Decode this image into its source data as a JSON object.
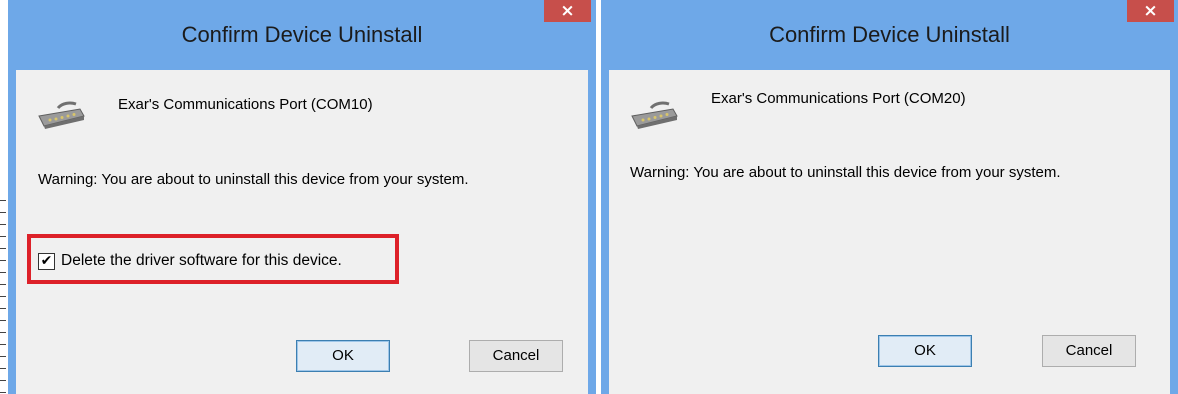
{
  "dialogs": [
    {
      "title": "Confirm Device Uninstall",
      "close_label": "×",
      "device_name": "Exar's Communications Port (COM10)",
      "warning": "Warning: You are about to uninstall this device from your system.",
      "checkbox": {
        "label": "Delete the driver software for this device.",
        "checked": true,
        "mark": "✔"
      },
      "ok_label": "OK",
      "cancel_label": "Cancel"
    },
    {
      "title": "Confirm Device Uninstall",
      "close_label": "×",
      "device_name": "Exar's Communications Port (COM20)",
      "warning": "Warning: You are about to uninstall this device from your system.",
      "ok_label": "OK",
      "cancel_label": "Cancel"
    }
  ],
  "colors": {
    "frame": "#6ea8e8",
    "close_button": "#c74f4b",
    "highlight": "#dd2129",
    "client": "#f0f0f0"
  },
  "icons": {
    "device": "serial-port-icon",
    "close": "close-icon",
    "check": "checkmark-icon"
  }
}
